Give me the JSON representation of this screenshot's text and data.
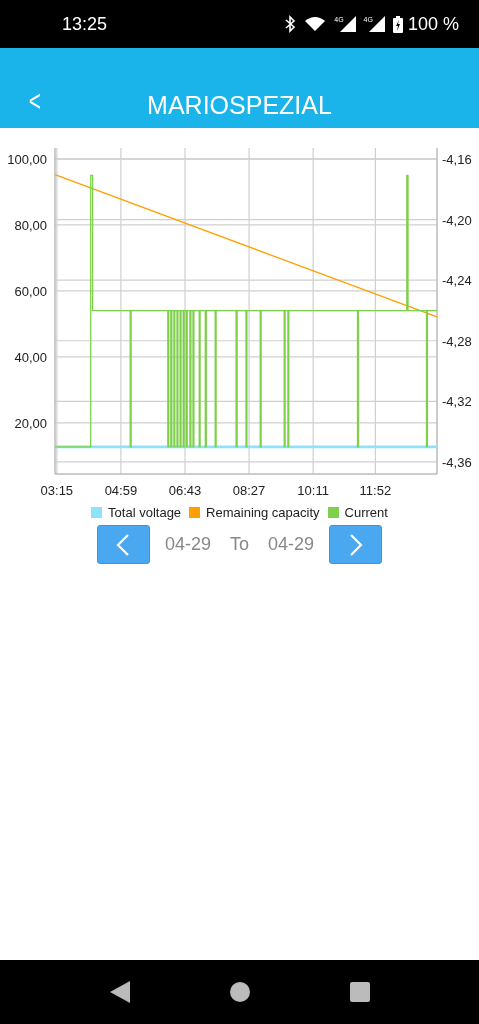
{
  "status_bar": {
    "time": "13:25",
    "network_labels": [
      "4G",
      "4G"
    ],
    "battery": "100 %"
  },
  "app_bar": {
    "back": "<",
    "title": "MARIOSPEZIAL"
  },
  "chart": {
    "chart_data": {
      "type": "line",
      "grid": true,
      "xlim": [
        192,
        812
      ],
      "ylim": [
        4.5,
        103.3
      ],
      "y2lim": [
        -4.368,
        -4.1527
      ],
      "xticks": [
        {
          "value": 195,
          "label": "03:15"
        },
        {
          "value": 299,
          "label": "04:59"
        },
        {
          "value": 403,
          "label": "06:43"
        },
        {
          "value": 507,
          "label": "08:27"
        },
        {
          "value": 611,
          "label": "10:11"
        },
        {
          "value": 712,
          "label": "11:52"
        }
      ],
      "yticks": [
        {
          "value": 100,
          "label": "100,00"
        },
        {
          "value": 80,
          "label": "80,00"
        },
        {
          "value": 60,
          "label": "60,00"
        },
        {
          "value": 40,
          "label": "40,00"
        },
        {
          "value": 20,
          "label": "20,00"
        }
      ],
      "y2ticks": [
        {
          "value": -4.16,
          "label": "-4,16"
        },
        {
          "value": -4.2,
          "label": "-4,20"
        },
        {
          "value": -4.24,
          "label": "-4,24"
        },
        {
          "value": -4.28,
          "label": "-4,28"
        },
        {
          "value": -4.32,
          "label": "-4,32"
        },
        {
          "value": -4.36,
          "label": "-4,36"
        }
      ],
      "series": [
        {
          "name": "Total voltage",
          "color": "#8ee3fa",
          "x": [
            192,
            812
          ],
          "values": [
            12.7,
            12.7
          ]
        },
        {
          "name": "Remaining capacity",
          "color": "#ffa000",
          "x": [
            192,
            812
          ],
          "values": [
            95.2,
            52.1
          ]
        },
        {
          "name": "Current",
          "color": "#7ed04b",
          "x": [
            192,
            250,
            250,
            253,
            253,
            314,
            314,
            315.5,
            315.5,
            375,
            375,
            376.5,
            376.5,
            380,
            380,
            381.5,
            381.5,
            385,
            385,
            386.5,
            386.5,
            390,
            390,
            391.5,
            391.5,
            395,
            395,
            396.5,
            396.5,
            400,
            400,
            401.5,
            401.5,
            405,
            405,
            406.5,
            406.5,
            411,
            411,
            412.5,
            412.5,
            416,
            416,
            417.5,
            417.5,
            426,
            426,
            427.5,
            427.5,
            436,
            436,
            437.5,
            437.5,
            452,
            452,
            453.5,
            453.5,
            486,
            486,
            487.5,
            487.5,
            502,
            502,
            503.5,
            503.5,
            525,
            525,
            526.5,
            526.5,
            564,
            564,
            565.5,
            565.5,
            570,
            570,
            571.5,
            571.5,
            683,
            683,
            684.5,
            684.5,
            763,
            763,
            765,
            765,
            795,
            795,
            796.5,
            796.5,
            812
          ],
          "values": [
            12.7,
            12.7,
            95,
            95,
            54,
            54,
            12.7,
            12.7,
            54,
            54,
            12.7,
            12.7,
            54,
            54,
            12.7,
            12.7,
            54,
            54,
            12.7,
            12.7,
            54,
            54,
            12.7,
            12.7,
            54,
            54,
            12.7,
            12.7,
            54,
            54,
            12.7,
            12.7,
            54,
            54,
            12.7,
            12.7,
            54,
            54,
            12.7,
            12.7,
            54,
            54,
            12.7,
            12.7,
            54,
            54,
            12.7,
            12.7,
            54,
            54,
            12.7,
            12.7,
            54,
            54,
            12.7,
            12.7,
            54,
            54,
            12.7,
            12.7,
            54,
            54,
            12.7,
            12.7,
            54,
            54,
            12.7,
            12.7,
            54,
            54,
            12.7,
            12.7,
            54,
            54,
            12.7,
            12.7,
            54,
            54,
            12.7,
            12.7,
            54,
            54,
            95,
            95,
            54,
            54,
            12.7,
            12.7,
            54,
            54
          ]
        }
      ]
    }
  },
  "date_range": {
    "from": "04-29",
    "separator": "To",
    "to": "04-29"
  }
}
